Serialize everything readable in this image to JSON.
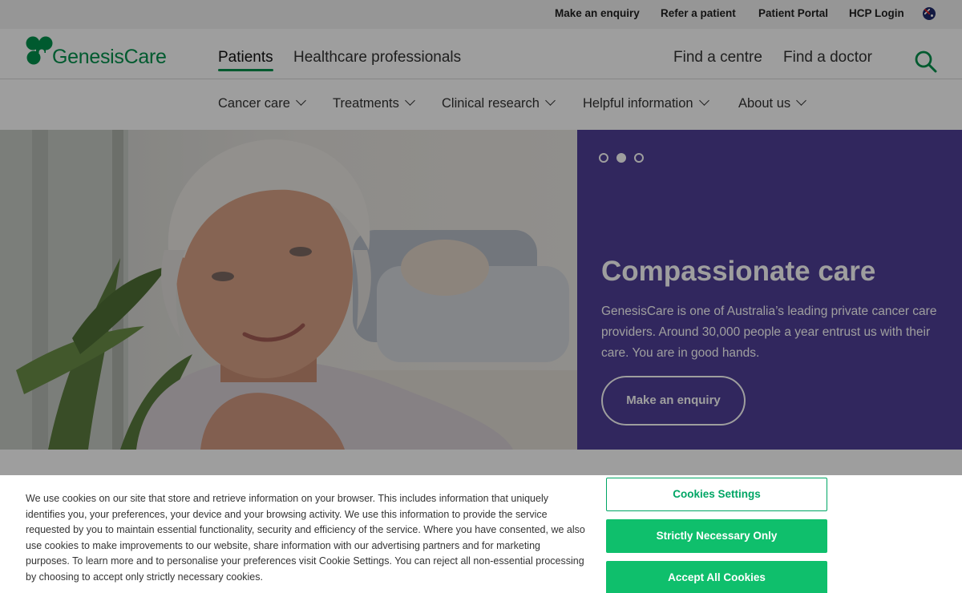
{
  "utility_nav": {
    "items": [
      "Make an enquiry",
      "Refer a patient",
      "Patient Portal",
      "HCP Login"
    ],
    "flag_icon": "australia-flag-icon"
  },
  "brand": {
    "name": "GenesisCare",
    "color": "#00924c"
  },
  "main_nav": {
    "tabs": [
      {
        "label": "Patients",
        "active": true
      },
      {
        "label": "Healthcare professionals",
        "active": false
      }
    ],
    "links": [
      "Find a centre",
      "Find a doctor"
    ],
    "search_icon": "search-icon"
  },
  "sub_nav": {
    "items": [
      {
        "label": "Cancer care"
      },
      {
        "label": "Treatments"
      },
      {
        "label": "Clinical research"
      },
      {
        "label": "Helpful information"
      },
      {
        "label": "About us"
      }
    ]
  },
  "hero": {
    "panel_color": "#4f3f98",
    "slides_count": 3,
    "active_slide": 2,
    "title": "Compassionate care",
    "body": "GenesisCare is one of Australia’s leading private cancer care providers. Around 30,000 people a year entrust us with their care.  You are in good hands.",
    "cta_label": "Make an enquiry"
  },
  "cookie_banner": {
    "text": "We use cookies on our site that store and retrieve information on your browser. This includes information that uniquely identifies you, your preferences, your device and your browsing activity. We use this information to provide the service requested by you to maintain essential functionality, security and efficiency of the service. Where you have consented, we also use cookies to make improvements to our website, share information with our advertising partners and for marketing purposes. To learn more and to personalise your preferences visit Cookie Settings. You can reject all non-essential processing by choosing to accept only strictly necessary cookies.",
    "settings_label": "Cookies Settings",
    "necessary_label": "Strictly Necessary Only",
    "accept_label": "Accept All Cookies",
    "accent_color": "#0fbf6c"
  }
}
